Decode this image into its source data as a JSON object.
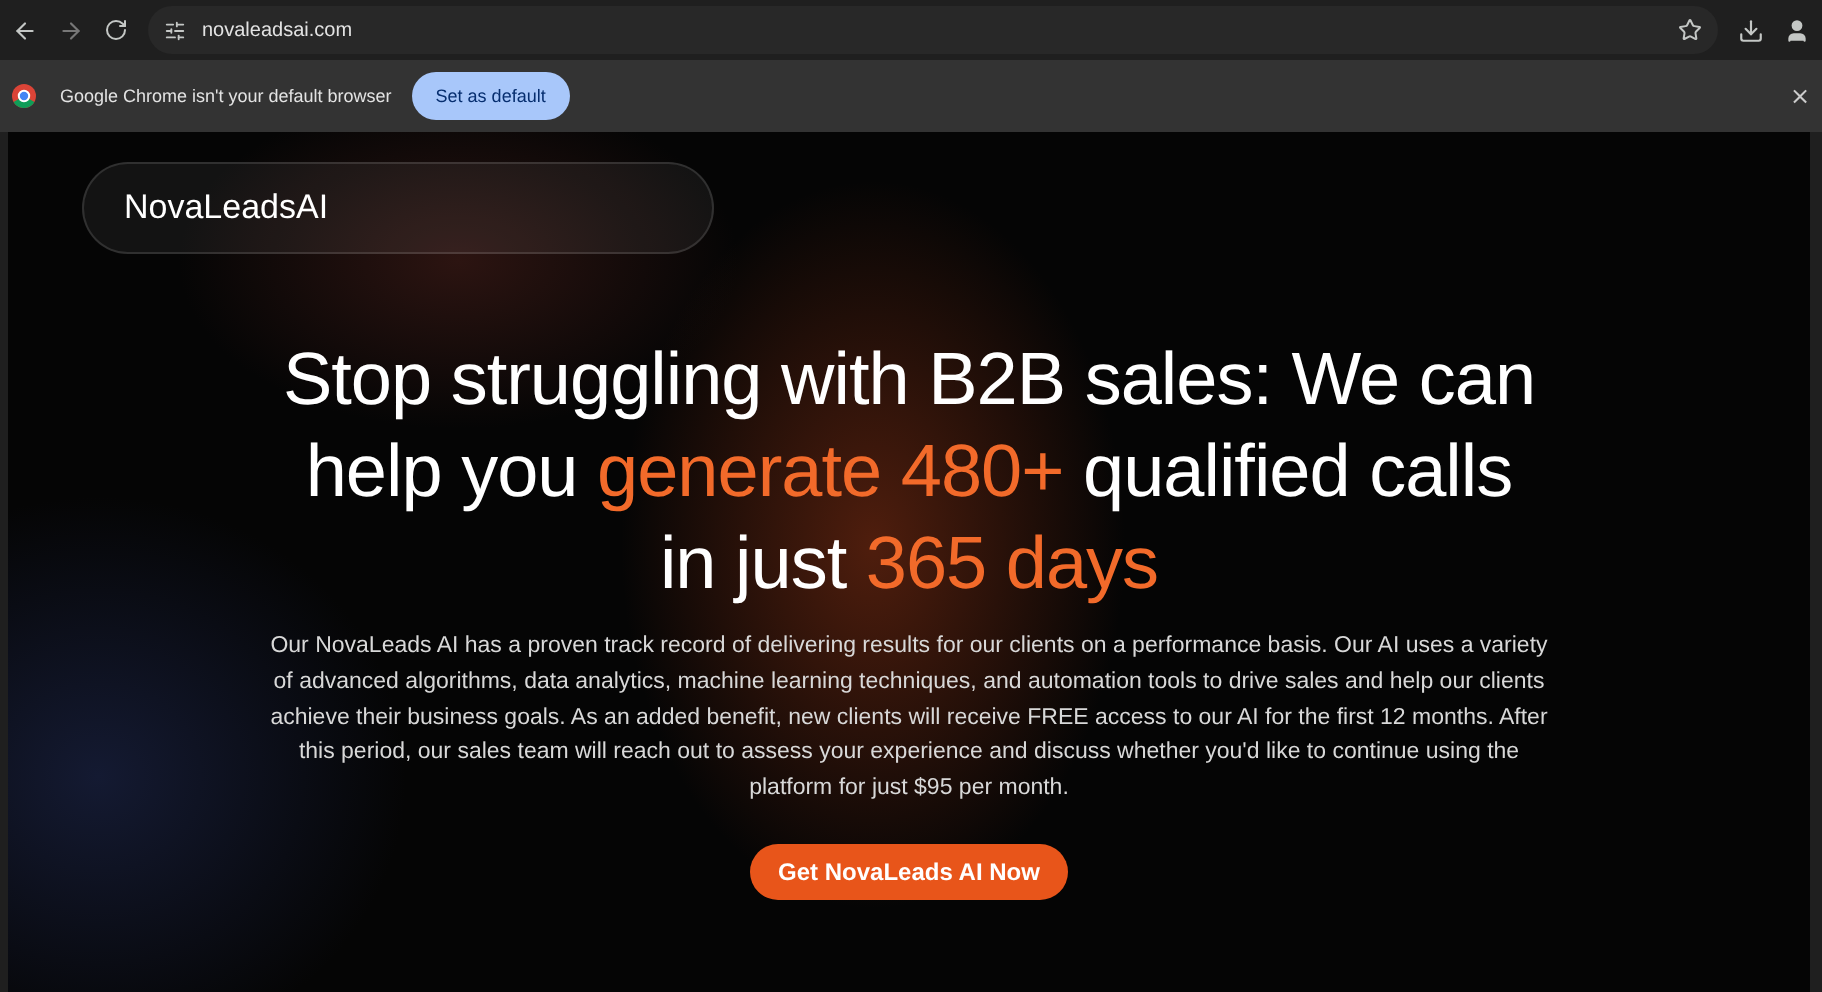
{
  "browser": {
    "url": "novaleadsai.com"
  },
  "infobar": {
    "message": "Google Chrome isn't your default browser",
    "button": "Set as default",
    "close": "×"
  },
  "logo": "NovaLeadsAI",
  "headline": [
    [
      {
        "text": "Stop struggling with B2B sales: We can",
        "highlighted": false
      }
    ],
    [
      {
        "text": "help you ",
        "highlighted": false
      },
      {
        "text": "generate 480+",
        "highlighted": true
      },
      {
        "text": " qualified calls",
        "highlighted": false
      }
    ],
    [
      {
        "text": "in just ",
        "highlighted": false
      },
      {
        "text": "365 days",
        "highlighted": true
      }
    ]
  ],
  "description": "Our NovaLeads AI has a proven track record of delivering results for our clients on a performance basis. Our AI uses a variety of advanced algorithms, data analytics, machine learning techniques, and automation tools to drive sales and help our clients achieve their business goals. As an added benefit, new clients will receive FREE access to our AI for the first 12 months. After this period, our sales team will reach out to assess your experience and discuss whether you'd like to continue using the platform for just $95 per month.",
  "cta": "Get NovaLeads AI Now"
}
